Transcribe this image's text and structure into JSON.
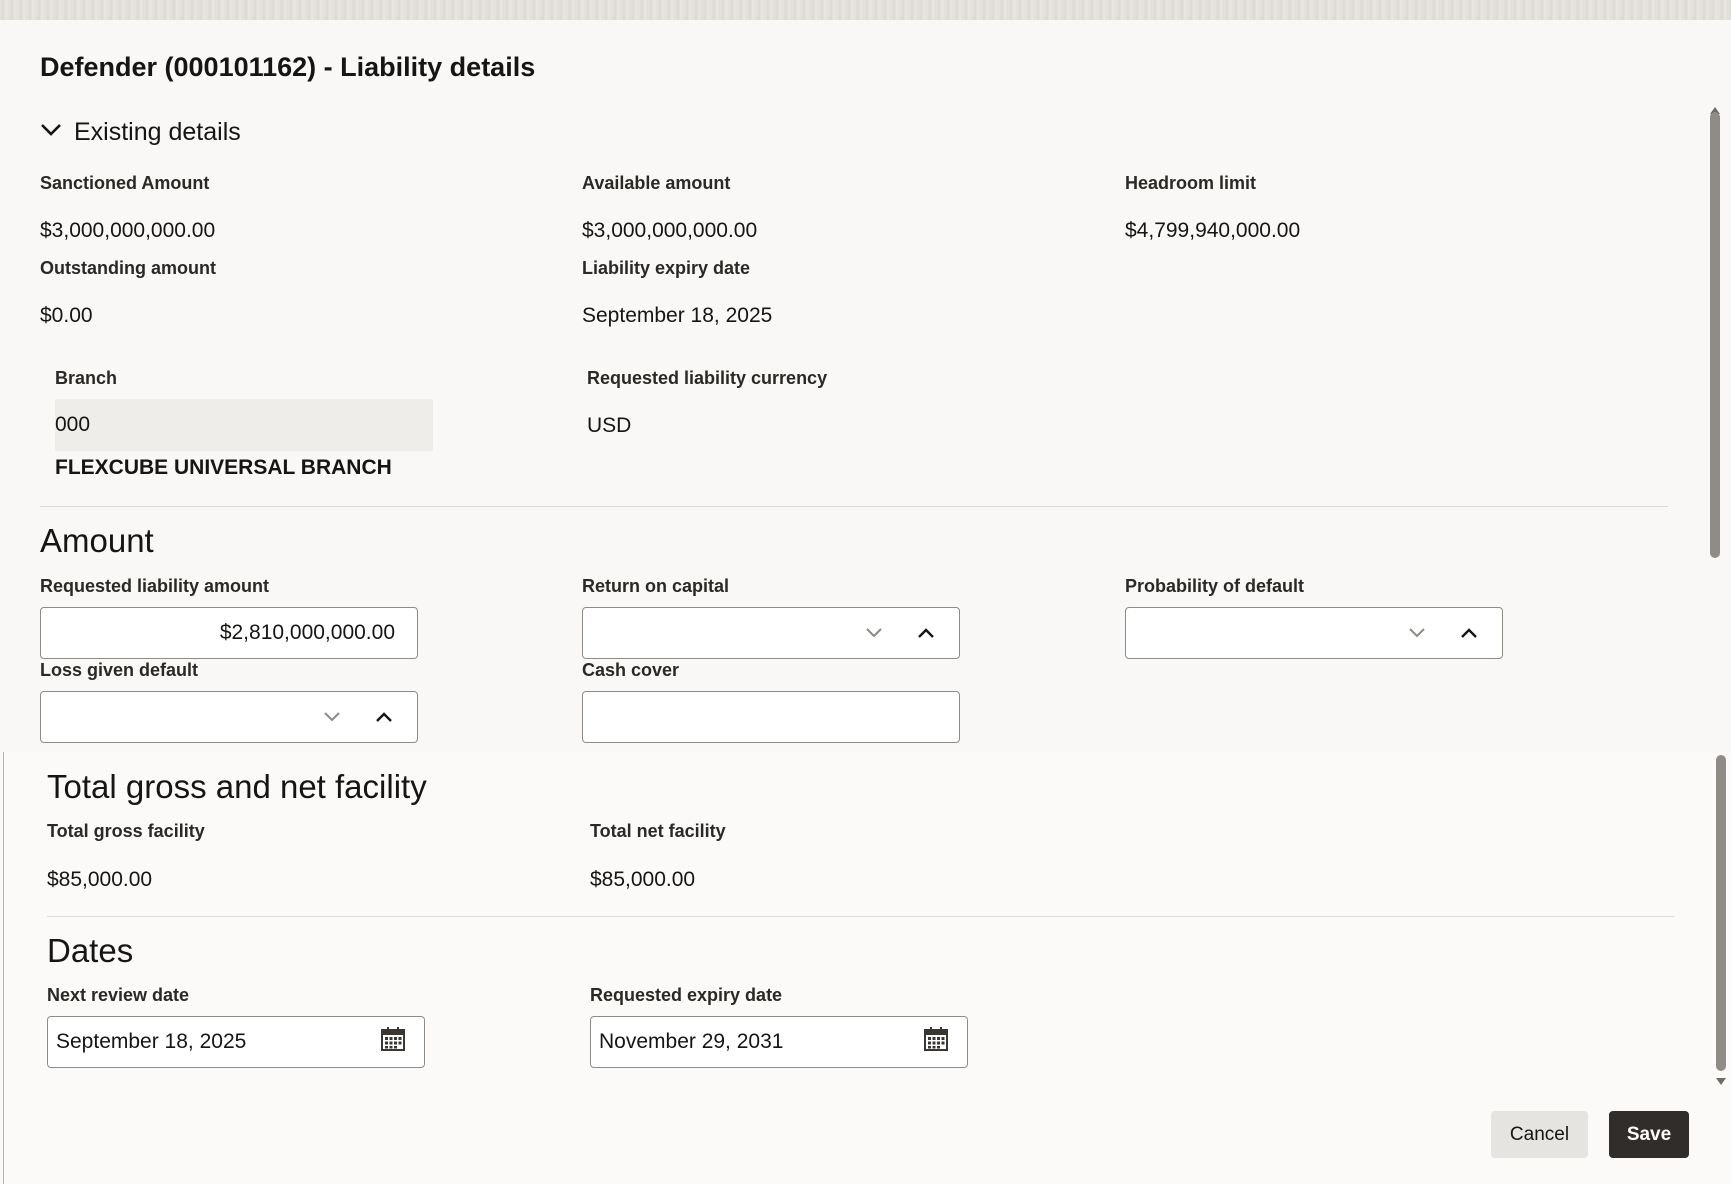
{
  "page": {
    "title": "Defender (000101162) - Liability details"
  },
  "existing": {
    "toggle_label": "Existing details",
    "sanctioned_label": "Sanctioned Amount",
    "sanctioned_value": "$3,000,000,000.00",
    "available_label": "Available amount",
    "available_value": "$3,000,000,000.00",
    "headroom_label": "Headroom limit",
    "headroom_value": "$4,799,940,000.00",
    "outstanding_label": "Outstanding amount",
    "outstanding_value": "$0.00",
    "expiry_label": "Liability expiry date",
    "expiry_value": "September 18, 2025",
    "branch_label": "Branch",
    "branch_code": "000",
    "branch_name": "FLEXCUBE UNIVERSAL BRANCH",
    "currency_label": "Requested liability currency",
    "currency_value": "USD"
  },
  "amount": {
    "heading": "Amount",
    "requested_label": "Requested liability amount",
    "requested_value": "$2,810,000,000.00",
    "roc_label": "Return on capital",
    "roc_value": "",
    "pd_label": "Probability of default",
    "pd_value": "",
    "lgd_label": "Loss given default",
    "lgd_value": "",
    "cash_cover_label": "Cash cover",
    "cash_cover_value": ""
  },
  "facility": {
    "heading": "Total gross and net facility",
    "gross_label": "Total gross facility",
    "gross_value": "$85,000.00",
    "net_label": "Total net facility",
    "net_value": "$85,000.00"
  },
  "dates": {
    "heading": "Dates",
    "next_review_label": "Next review date",
    "next_review_value": "September 18, 2025",
    "req_expiry_label": "Requested expiry date",
    "req_expiry_value": "November 29, 2031"
  },
  "actions": {
    "cancel_label": "Cancel",
    "save_label": "Save"
  },
  "colors": {
    "save_bg": "#312d2a",
    "page_bg": "#f9f8f6"
  }
}
